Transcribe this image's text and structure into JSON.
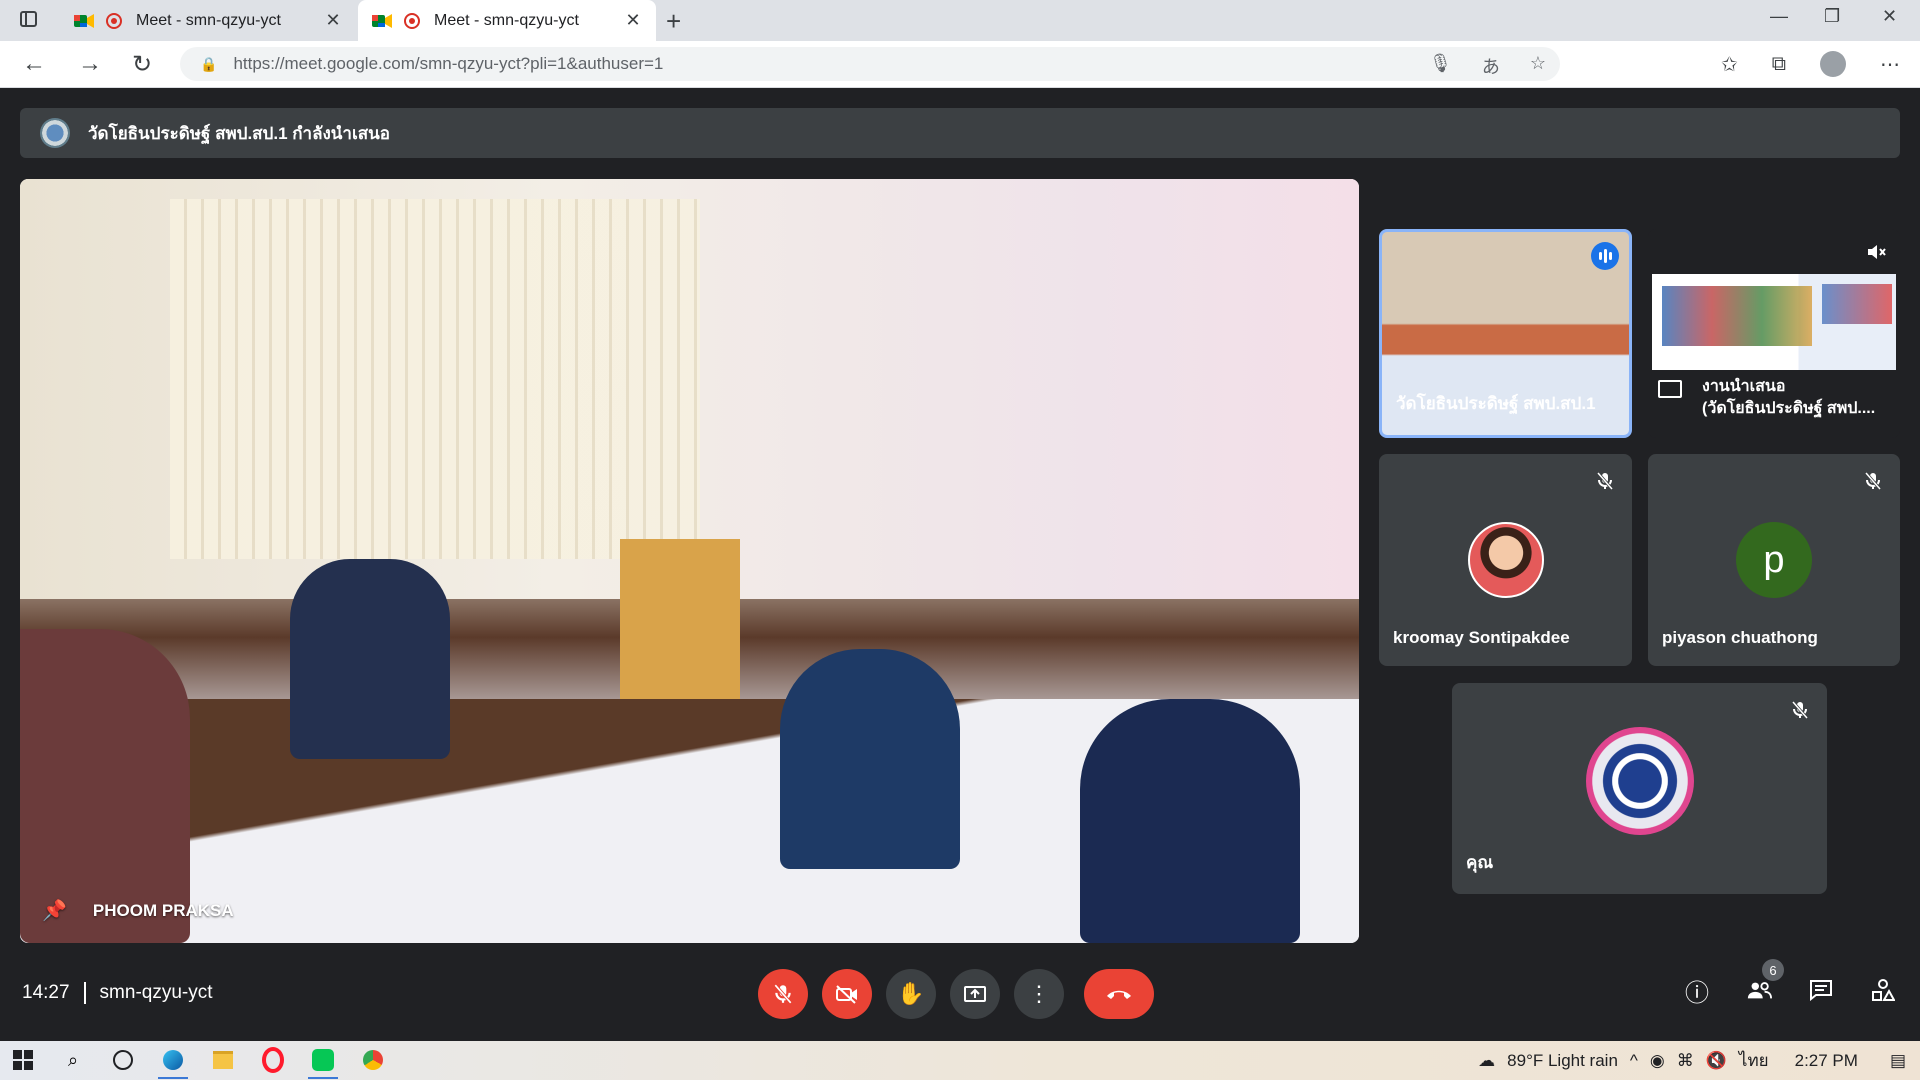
{
  "browser": {
    "tabs": [
      {
        "title": "Meet - smn-qzyu-yct",
        "active": false
      },
      {
        "title": "Meet - smn-qzyu-yct",
        "active": true
      }
    ],
    "url": "https://meet.google.com/smn-qzyu-yct?pli=1&authuser=1",
    "window_controls": {
      "minimize": "—",
      "restore": "❐",
      "close": "✕"
    }
  },
  "meet": {
    "banner_text": "วัดโยธินประดิษฐ์ สพป.สป.1 กำลังนำเสนอ",
    "main_speaker": "PHOOM PRAKSA",
    "tiles": [
      {
        "name": "วัดโยธินประดิษฐ์ สพป.สป.1",
        "speaking": true
      },
      {
        "name_line1": "งานนำเสนอ",
        "name_line2": "(วัดโยธินประดิษฐ์ สพป...."
      },
      {
        "name": "kroomay Sontipakdee",
        "muted": true
      },
      {
        "name": "piyason chuathong",
        "initial": "p",
        "muted": true,
        "avatar_color": "#33691e"
      },
      {
        "name": "คุณ",
        "muted": true
      }
    ],
    "time": "14:27",
    "meeting_code": "smn-qzyu-yct",
    "participants_count": "6"
  },
  "taskbar": {
    "weather": "89°F  Light rain",
    "language": "ไทย",
    "clock": "2:27 PM"
  }
}
